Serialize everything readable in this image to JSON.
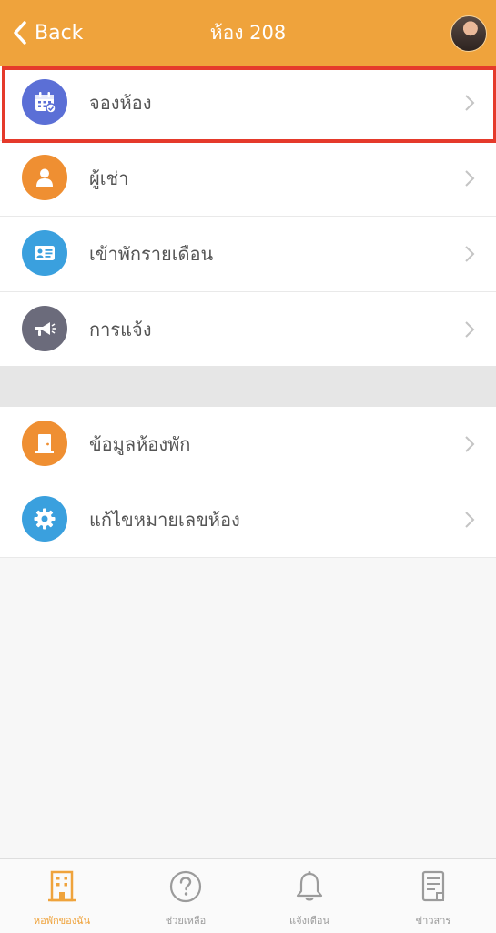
{
  "header": {
    "back_label": "Back",
    "title": "ห้อง 208"
  },
  "menu": {
    "group1": [
      {
        "label": "จองห้อง",
        "icon": "calendar-check-icon",
        "color": "#5b6fd6"
      },
      {
        "label": "ผู้เช่า",
        "icon": "person-icon",
        "color": "#ef8f32"
      },
      {
        "label": "เข้าพักรายเดือน",
        "icon": "id-card-icon",
        "color": "#3aa0de"
      },
      {
        "label": "การแจ้ง",
        "icon": "megaphone-icon",
        "color": "#6b6b7b"
      }
    ],
    "group2": [
      {
        "label": "ข้อมูลห้องพัก",
        "icon": "door-icon",
        "color": "#ef8f32"
      },
      {
        "label": "แก้ไขหมายเลขห้อง",
        "icon": "gear-icon",
        "color": "#3aa0de"
      }
    ]
  },
  "tabbar": {
    "tabs": [
      {
        "label": "หอพักของฉัน",
        "icon": "building-icon",
        "active": true
      },
      {
        "label": "ช่วยเหลือ",
        "icon": "help-icon",
        "active": false
      },
      {
        "label": "แจ้งเตือน",
        "icon": "bell-icon",
        "active": false
      },
      {
        "label": "ข่าวสาร",
        "icon": "news-icon",
        "active": false
      }
    ]
  },
  "colors": {
    "header": "#efa33c",
    "highlight_border": "#e53a2b",
    "active_tab": "#efa33c",
    "inactive_tab": "#9b9b9b"
  }
}
